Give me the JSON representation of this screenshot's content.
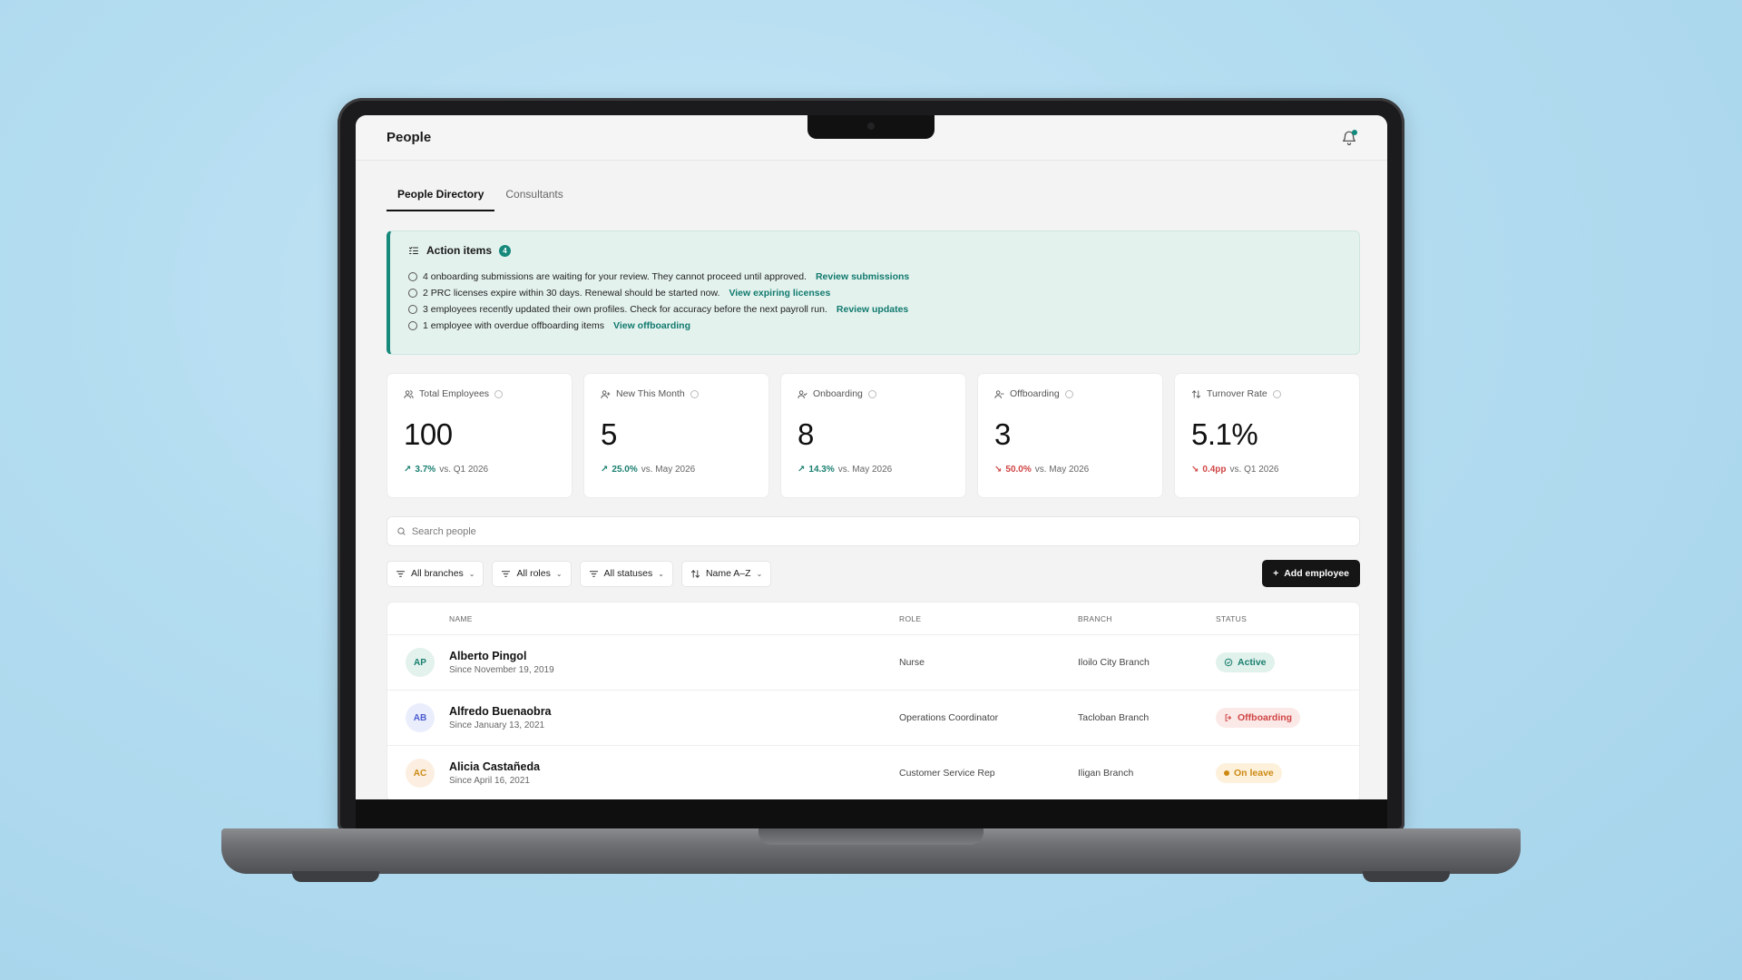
{
  "app": {
    "page_title": "People"
  },
  "tabs": [
    {
      "label": "People Directory",
      "active": true
    },
    {
      "label": "Consultants",
      "active": false
    }
  ],
  "action_items": {
    "title": "Action items",
    "count": "4",
    "items": [
      {
        "text": "4 onboarding submissions are waiting for your review. They cannot proceed until approved.",
        "link": "Review submissions"
      },
      {
        "text": "2 PRC licenses expire within 30 days. Renewal should be started now.",
        "link": "View expiring licenses"
      },
      {
        "text": "3 employees recently updated their own profiles. Check for accuracy before the next payroll run.",
        "link": "Review updates"
      },
      {
        "text": "1 employee with overdue offboarding items",
        "link": "View offboarding"
      }
    ]
  },
  "stats": [
    {
      "label": "Total Employees",
      "value": "100",
      "trend": "3.7%",
      "direction": "up",
      "compare": "vs. Q1 2026",
      "icon": "users-icon"
    },
    {
      "label": "New This Month",
      "value": "5",
      "trend": "25.0%",
      "direction": "up",
      "compare": "vs. May 2026",
      "icon": "user-plus-icon"
    },
    {
      "label": "Onboarding",
      "value": "8",
      "trend": "14.3%",
      "direction": "up",
      "compare": "vs. May 2026",
      "icon": "user-check-icon"
    },
    {
      "label": "Offboarding",
      "value": "3",
      "trend": "50.0%",
      "direction": "down",
      "compare": "vs. May 2026",
      "icon": "user-minus-icon"
    },
    {
      "label": "Turnover Rate",
      "value": "5.1%",
      "trend": "0.4pp",
      "direction": "down",
      "compare": "vs. Q1 2026",
      "icon": "swap-icon"
    }
  ],
  "search": {
    "placeholder": "Search people"
  },
  "filters": {
    "branches": "All branches",
    "roles": "All roles",
    "statuses": "All statuses",
    "sort": "Name A–Z",
    "add_button": "Add employee"
  },
  "table": {
    "headers": {
      "name": "NAME",
      "role": "ROLE",
      "branch": "BRANCH",
      "status": "STATUS"
    },
    "rows": [
      {
        "initials": "AP",
        "name": "Alberto Pingol",
        "since": "Since November 19, 2019",
        "role": "Nurse",
        "branch": "Iloilo City Branch",
        "status": "Active"
      },
      {
        "initials": "AB",
        "name": "Alfredo Buenaobra",
        "since": "Since January 13, 2021",
        "role": "Operations Coordinator",
        "branch": "Tacloban Branch",
        "status": "Offboarding"
      },
      {
        "initials": "AC",
        "name": "Alicia Castañeda",
        "since": "Since April 16, 2021",
        "role": "Customer Service Rep",
        "branch": "Iligan Branch",
        "status": "On leave"
      }
    ]
  },
  "colors": {
    "accent": "#16897b",
    "background": "#b3dcf0",
    "trend_up": "#1a7f6f",
    "trend_down": "#d04545",
    "status_active": "#1a7f6f",
    "status_offboarding": "#d04545",
    "status_on_leave": "#cc8a12"
  }
}
